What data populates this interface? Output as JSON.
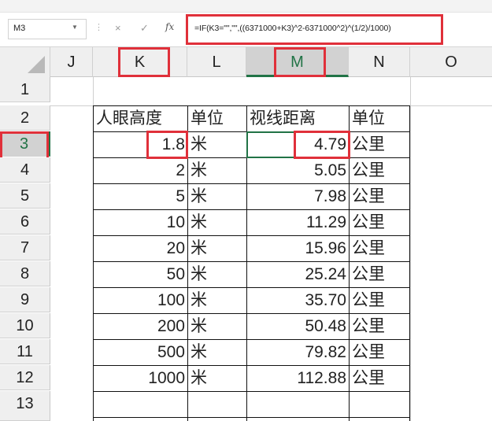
{
  "name_box": "M3",
  "formula_bar": {
    "cancel_icon": "×",
    "enter_icon": "✓",
    "fx_label": "fx",
    "formula": "=IF(K3=\"\",\"\",((6371000+K3)^2-6371000^2)^(1/2)/1000)"
  },
  "columns": [
    "J",
    "K",
    "L",
    "M",
    "N",
    "O"
  ],
  "rows": [
    "1",
    "2",
    "3",
    "4",
    "5",
    "6",
    "7",
    "8",
    "9",
    "10",
    "11",
    "12",
    "13"
  ],
  "table": {
    "headers": [
      "人眼高度",
      "单位",
      "视线距离",
      "单位"
    ],
    "data": [
      [
        "1.8",
        "米",
        "4.79",
        "公里"
      ],
      [
        "2",
        "米",
        "5.05",
        "公里"
      ],
      [
        "5",
        "米",
        "7.98",
        "公里"
      ],
      [
        "10",
        "米",
        "11.29",
        "公里"
      ],
      [
        "20",
        "米",
        "15.96",
        "公里"
      ],
      [
        "50",
        "米",
        "25.24",
        "公里"
      ],
      [
        "100",
        "米",
        "35.70",
        "公里"
      ],
      [
        "200",
        "米",
        "50.48",
        "公里"
      ],
      [
        "500",
        "米",
        "79.82",
        "公里"
      ],
      [
        "1000",
        "米",
        "112.88",
        "公里"
      ]
    ]
  },
  "colors": {
    "highlight": "#e0303a",
    "selection": "#217346"
  }
}
